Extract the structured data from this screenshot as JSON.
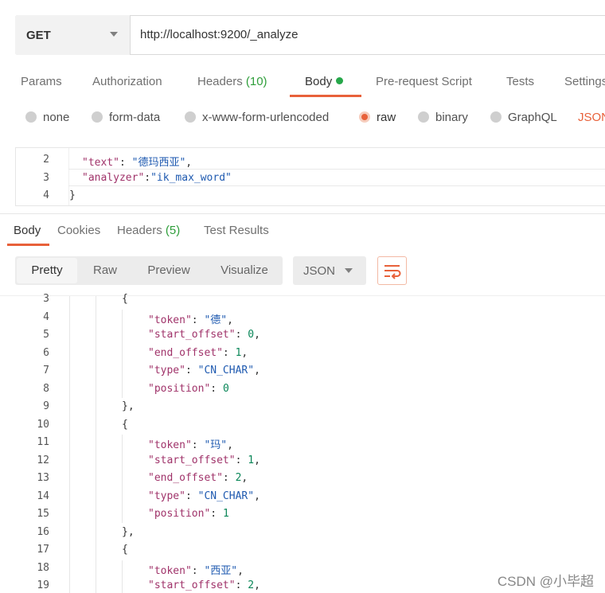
{
  "request": {
    "method": "GET",
    "url": "http://localhost:9200/_analyze"
  },
  "request_tabs": [
    {
      "label": "Params"
    },
    {
      "label": "Authorization"
    },
    {
      "label": "Headers",
      "count": "(10)"
    },
    {
      "label": "Body"
    },
    {
      "label": "Pre-request Script"
    },
    {
      "label": "Tests"
    },
    {
      "label": "Settings"
    }
  ],
  "body_types": {
    "none": "none",
    "form_data": "form-data",
    "urlencoded": "x-www-form-urlencoded",
    "raw": "raw",
    "binary": "binary",
    "graphql": "GraphQL",
    "json": "JSON"
  },
  "request_body": [
    {
      "n": "2",
      "key": "\"text\"",
      "sep": ": ",
      "val": "\"德玛西亚\"",
      "end": ","
    },
    {
      "n": "3",
      "key": "\"analyzer\"",
      "sep": ":",
      "val": "\"ik_max_word\"",
      "end": ""
    },
    {
      "n": "4",
      "text": "}"
    }
  ],
  "response_tabs": [
    {
      "label": "Body"
    },
    {
      "label": "Cookies"
    },
    {
      "label": "Headers",
      "count": "(5)"
    },
    {
      "label": "Test Results"
    }
  ],
  "view_modes": [
    "Pretty",
    "Raw",
    "Preview",
    "Visualize"
  ],
  "format": "JSON",
  "response_lines": [
    {
      "n": "3",
      "indent": 2,
      "text": "{"
    },
    {
      "n": "4",
      "indent": 3,
      "key": "\"token\"",
      "val": "\"德\"",
      "type": "s",
      "end": ","
    },
    {
      "n": "5",
      "indent": 3,
      "key": "\"start_offset\"",
      "val": "0",
      "type": "n",
      "end": ","
    },
    {
      "n": "6",
      "indent": 3,
      "key": "\"end_offset\"",
      "val": "1",
      "type": "n",
      "end": ","
    },
    {
      "n": "7",
      "indent": 3,
      "key": "\"type\"",
      "val": "\"CN_CHAR\"",
      "type": "s",
      "end": ","
    },
    {
      "n": "8",
      "indent": 3,
      "key": "\"position\"",
      "val": "0",
      "type": "n",
      "end": ""
    },
    {
      "n": "9",
      "indent": 2,
      "text": "},"
    },
    {
      "n": "10",
      "indent": 2,
      "text": "{"
    },
    {
      "n": "11",
      "indent": 3,
      "key": "\"token\"",
      "val": "\"玛\"",
      "type": "s",
      "end": ","
    },
    {
      "n": "12",
      "indent": 3,
      "key": "\"start_offset\"",
      "val": "1",
      "type": "n",
      "end": ","
    },
    {
      "n": "13",
      "indent": 3,
      "key": "\"end_offset\"",
      "val": "2",
      "type": "n",
      "end": ","
    },
    {
      "n": "14",
      "indent": 3,
      "key": "\"type\"",
      "val": "\"CN_CHAR\"",
      "type": "s",
      "end": ","
    },
    {
      "n": "15",
      "indent": 3,
      "key": "\"position\"",
      "val": "1",
      "type": "n",
      "end": ""
    },
    {
      "n": "16",
      "indent": 2,
      "text": "},"
    },
    {
      "n": "17",
      "indent": 2,
      "text": "{"
    },
    {
      "n": "18",
      "indent": 3,
      "key": "\"token\"",
      "val": "\"西亚\"",
      "type": "s",
      "end": ","
    },
    {
      "n": "19",
      "indent": 3,
      "key": "\"start_offset\"",
      "val": "2",
      "type": "n",
      "end": ","
    }
  ],
  "watermark": "CSDN @小毕超",
  "colors": {
    "accent": "#e8613a",
    "count_green": "#2e9e3a",
    "json_key": "#a0336a",
    "json_string": "#1f5ab0",
    "json_number": "#098658"
  }
}
